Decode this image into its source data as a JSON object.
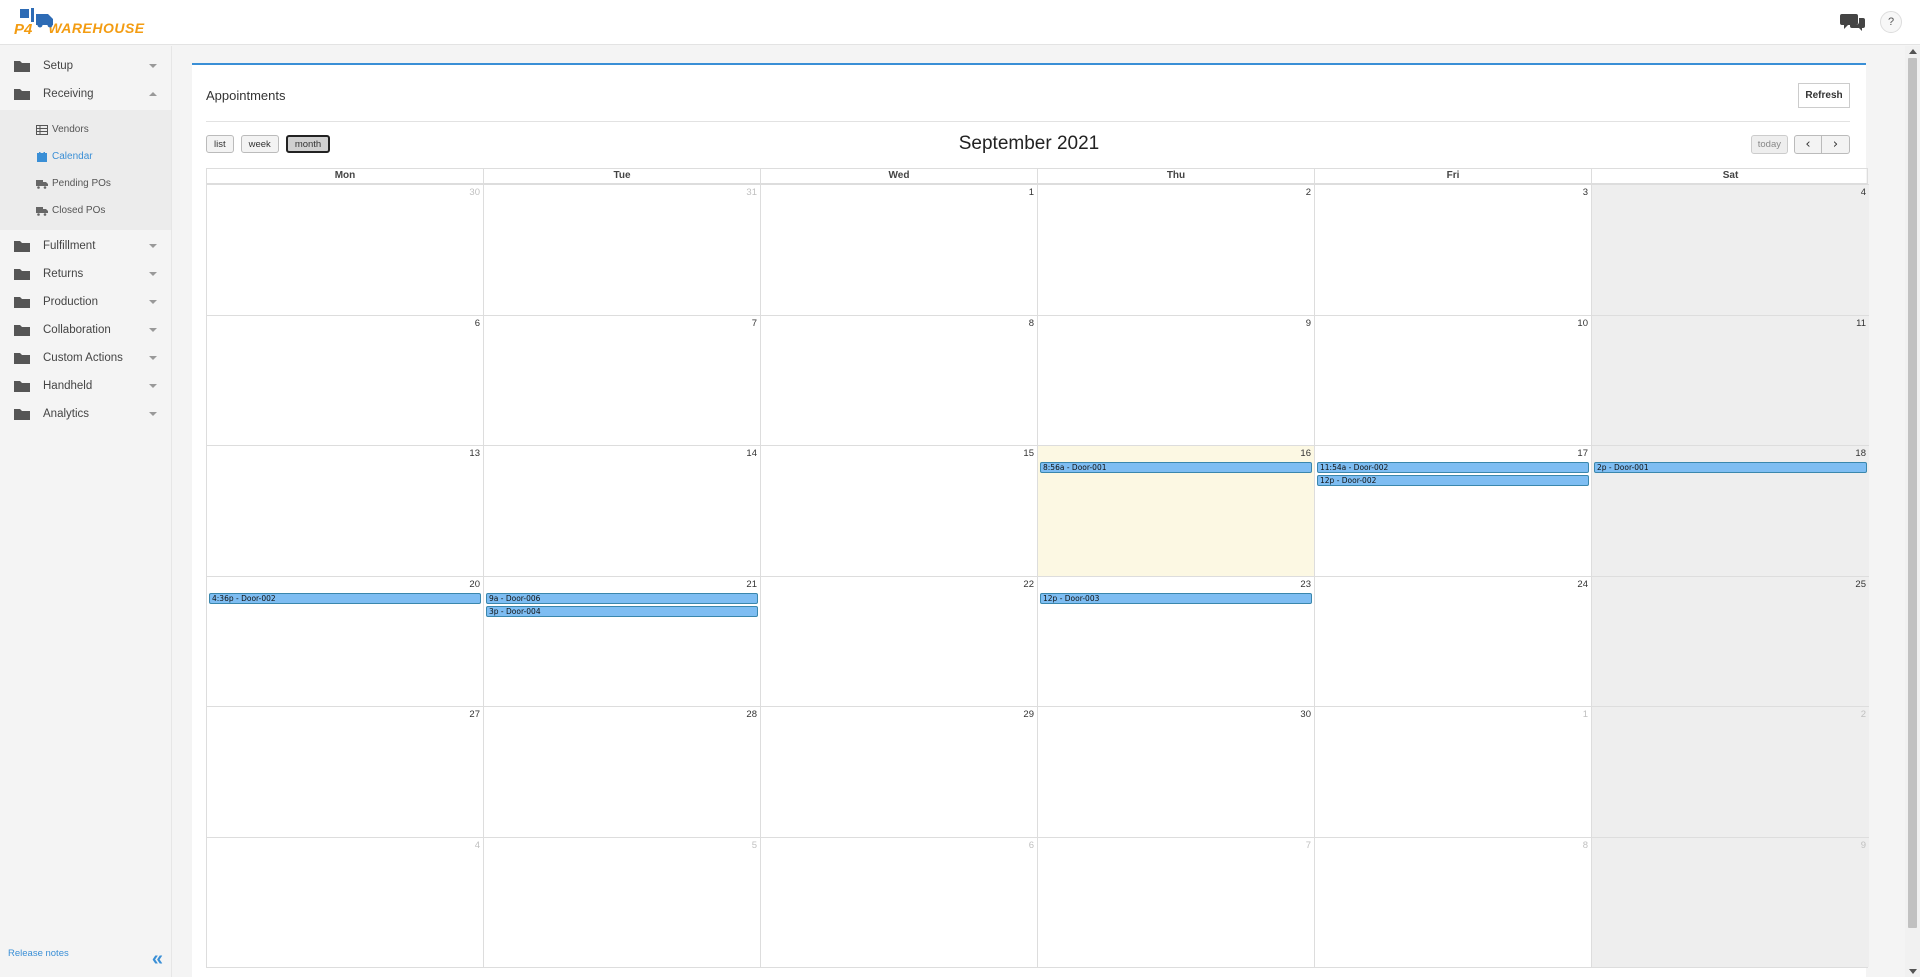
{
  "app": {
    "logo_text_left": "P4",
    "logo_text_right": "WAREHOUSE",
    "help_label": "?"
  },
  "sidebar": {
    "items": [
      {
        "label": "Setup",
        "expanded": false
      },
      {
        "label": "Receiving",
        "expanded": true
      },
      {
        "label": "Fulfillment",
        "expanded": false
      },
      {
        "label": "Returns",
        "expanded": false
      },
      {
        "label": "Production",
        "expanded": false
      },
      {
        "label": "Collaboration",
        "expanded": false
      },
      {
        "label": "Custom Actions",
        "expanded": false
      },
      {
        "label": "Handheld",
        "expanded": false
      },
      {
        "label": "Analytics",
        "expanded": false
      }
    ],
    "receiving_sub": [
      {
        "label": "Vendors",
        "icon": "table-icon",
        "active": false
      },
      {
        "label": "Calendar",
        "icon": "calendar-icon",
        "active": true
      },
      {
        "label": "Pending POs",
        "icon": "truck-icon",
        "active": false
      },
      {
        "label": "Closed POs",
        "icon": "truck-icon",
        "active": false
      }
    ],
    "release_notes": "Release notes",
    "collapse_glyph": "«"
  },
  "panel": {
    "title": "Appointments",
    "refresh_label": "Refresh"
  },
  "calendar": {
    "title": "September 2021",
    "views": [
      "list",
      "week",
      "month"
    ],
    "active_view": "month",
    "today_label": "today",
    "prev_glyph": "‹",
    "next_glyph": "›",
    "weekdays": [
      "Mon",
      "Tue",
      "Wed",
      "Thu",
      "Fri",
      "Sat"
    ],
    "weeks": [
      [
        {
          "day": "30",
          "other": true,
          "events": []
        },
        {
          "day": "31",
          "other": true,
          "events": []
        },
        {
          "day": "1",
          "events": []
        },
        {
          "day": "2",
          "events": []
        },
        {
          "day": "3",
          "events": []
        },
        {
          "day": "4",
          "weekend": true,
          "events": []
        }
      ],
      [
        {
          "day": "6",
          "events": []
        },
        {
          "day": "7",
          "events": []
        },
        {
          "day": "8",
          "events": []
        },
        {
          "day": "9",
          "events": []
        },
        {
          "day": "10",
          "events": []
        },
        {
          "day": "11",
          "weekend": true,
          "events": []
        }
      ],
      [
        {
          "day": "13",
          "events": []
        },
        {
          "day": "14",
          "events": []
        },
        {
          "day": "15",
          "events": []
        },
        {
          "day": "16",
          "today": true,
          "events": [
            "8:56a - Door-001"
          ]
        },
        {
          "day": "17",
          "events": [
            "11:54a - Door-002",
            "12p - Door-002"
          ]
        },
        {
          "day": "18",
          "weekend": true,
          "events": [
            "2p - Door-001"
          ]
        }
      ],
      [
        {
          "day": "20",
          "events": [
            "4:36p - Door-002"
          ]
        },
        {
          "day": "21",
          "events": [
            "9a - Door-006",
            "3p - Door-004"
          ]
        },
        {
          "day": "22",
          "events": []
        },
        {
          "day": "23",
          "events": [
            "12p - Door-003"
          ]
        },
        {
          "day": "24",
          "events": []
        },
        {
          "day": "25",
          "weekend": true,
          "events": []
        }
      ],
      [
        {
          "day": "27",
          "events": []
        },
        {
          "day": "28",
          "events": []
        },
        {
          "day": "29",
          "events": []
        },
        {
          "day": "30",
          "events": []
        },
        {
          "day": "1",
          "other": true,
          "events": []
        },
        {
          "day": "2",
          "other": true,
          "weekend": true,
          "events": []
        }
      ],
      [
        {
          "day": "4",
          "other": true,
          "events": []
        },
        {
          "day": "5",
          "other": true,
          "events": []
        },
        {
          "day": "6",
          "other": true,
          "events": []
        },
        {
          "day": "7",
          "other": true,
          "events": []
        },
        {
          "day": "8",
          "other": true,
          "events": []
        },
        {
          "day": "9",
          "other": true,
          "weekend": true,
          "events": []
        }
      ]
    ]
  }
}
